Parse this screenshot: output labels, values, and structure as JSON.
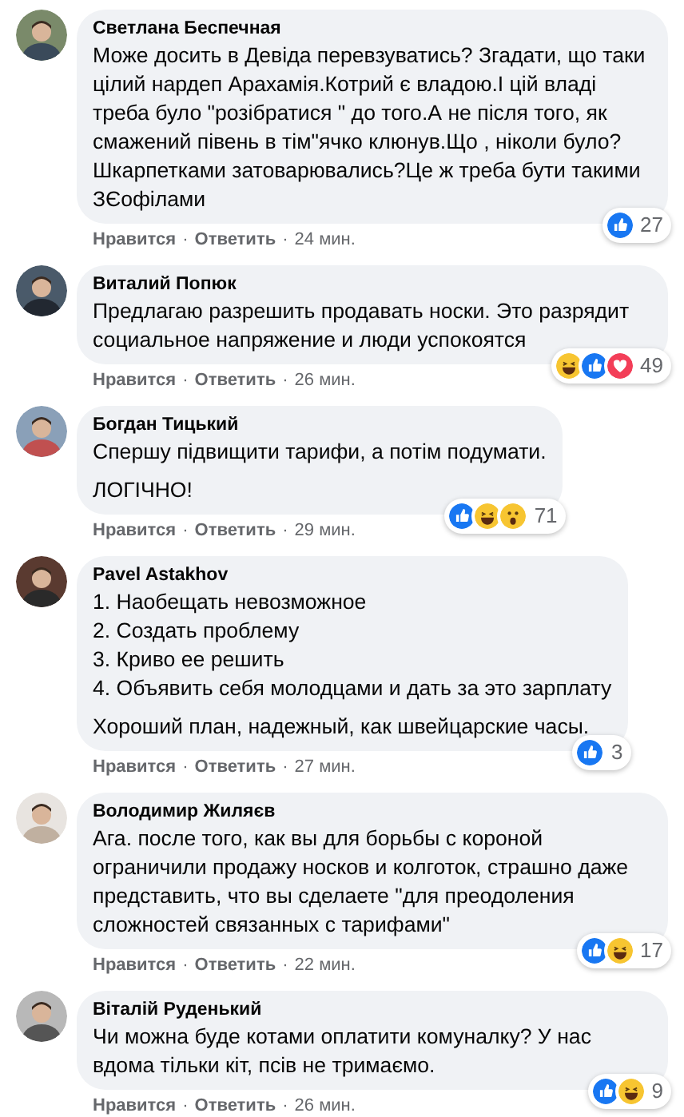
{
  "comments": [
    {
      "author": "Светлана Беспечная",
      "avatar": {
        "kind": "picture"
      },
      "paragraphs": [
        "Може досить в Девіда перевзуватись? Згадати, що таки цілий нардеп Арахамія.Котрий є владою.І цій владі треба було \"розібратися \" до того.А не після того, як смажений півень в тім\"ячко клюнув.Що , ніколи було? Шкарпетками затоварювались?Це ж треба бути такими ЗЄофілами"
      ],
      "reactions": [
        {
          "kind": "like"
        }
      ],
      "reaction_count": "27",
      "actions": [
        {
          "kind": "link",
          "text": "Нравится"
        },
        {
          "kind": "sep",
          "text": "·"
        },
        {
          "kind": "link",
          "text": "Ответить"
        },
        {
          "kind": "sep",
          "text": "·"
        },
        {
          "kind": "time",
          "text": "24 мин."
        }
      ]
    },
    {
      "author": "Виталий Попюк",
      "avatar": {
        "kind": "picture"
      },
      "paragraphs": [
        "Предлагаю разрешить продавать носки. Это разрядит социальное напряжение и люди успокоятся"
      ],
      "reactions": [
        {
          "kind": "haha"
        },
        {
          "kind": "like"
        },
        {
          "kind": "love"
        }
      ],
      "reaction_count": "49",
      "actions": [
        {
          "kind": "link",
          "text": "Нравится"
        },
        {
          "kind": "sep",
          "text": "·"
        },
        {
          "kind": "link",
          "text": "Ответить"
        },
        {
          "kind": "sep",
          "text": "·"
        },
        {
          "kind": "time",
          "text": "26 мин."
        }
      ]
    },
    {
      "author": "Богдан Тицький",
      "avatar": {
        "kind": "picture"
      },
      "paragraphs": [
        "Спершу підвищити тарифи, а потім подумати.",
        "ЛОГІЧНО!"
      ],
      "reactions": [
        {
          "kind": "like"
        },
        {
          "kind": "haha"
        },
        {
          "kind": "wow"
        }
      ],
      "reaction_count": "71",
      "actions": [
        {
          "kind": "link",
          "text": "Нравится"
        },
        {
          "kind": "sep",
          "text": "·"
        },
        {
          "kind": "link",
          "text": "Ответить"
        },
        {
          "kind": "sep",
          "text": "·"
        },
        {
          "kind": "time",
          "text": "29 мин."
        }
      ]
    },
    {
      "author": "Pavel Astakhov",
      "avatar": {
        "kind": "picture"
      },
      "paragraphs": [
        "1. Наобещать невозможное\n2. Создать проблему\n3. Криво ее решить\n4. Объявить себя молодцами и дать за это зарплату",
        "Хороший план, надежный, как швейцарские часы."
      ],
      "reactions": [
        {
          "kind": "like"
        }
      ],
      "reaction_count": "3",
      "actions": [
        {
          "kind": "link",
          "text": "Нравится"
        },
        {
          "kind": "sep",
          "text": "·"
        },
        {
          "kind": "link",
          "text": "Ответить"
        },
        {
          "kind": "sep",
          "text": "·"
        },
        {
          "kind": "time",
          "text": "27 мин."
        }
      ]
    },
    {
      "author": "Володимир Жиляєв",
      "avatar": {
        "kind": "picture"
      },
      "paragraphs": [
        "Ага. после того, как вы для борьбы с короной ограничили продажу носков и колготок, страшно даже представить, что вы сделаете \"для преодоления сложностей связанных с тарифами\""
      ],
      "reactions": [
        {
          "kind": "like"
        },
        {
          "kind": "haha"
        }
      ],
      "reaction_count": "17",
      "actions": [
        {
          "kind": "link",
          "text": "Нравится"
        },
        {
          "kind": "sep",
          "text": "·"
        },
        {
          "kind": "link",
          "text": "Ответить"
        },
        {
          "kind": "sep",
          "text": "·"
        },
        {
          "kind": "time",
          "text": "22 мин."
        }
      ]
    },
    {
      "author": "Віталій Руденький",
      "avatar": {
        "kind": "picture"
      },
      "paragraphs": [
        "Чи можна буде котами оплатити комуналку? У нас вдома тільки кіт, псів не тримаємо."
      ],
      "reactions": [
        {
          "kind": "like"
        },
        {
          "kind": "haha"
        }
      ],
      "reaction_count": "9",
      "actions": [
        {
          "kind": "link",
          "text": "Нравится"
        },
        {
          "kind": "sep",
          "text": "·"
        },
        {
          "kind": "link",
          "text": "Ответить"
        },
        {
          "kind": "sep",
          "text": "·"
        },
        {
          "kind": "time",
          "text": "26 мин."
        }
      ]
    }
  ]
}
